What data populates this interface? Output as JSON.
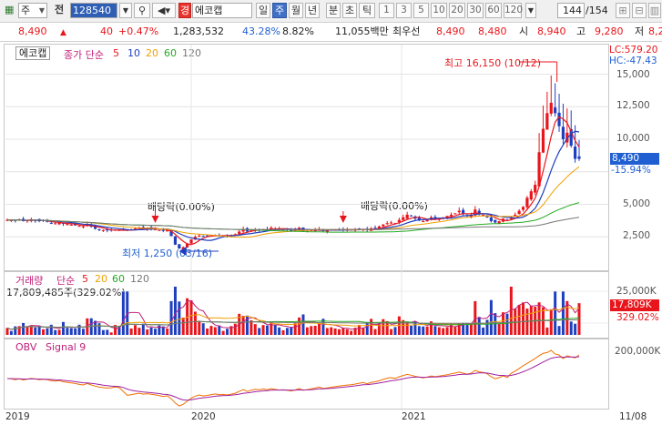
{
  "toolbar": {
    "market_type": "주",
    "prev_label": "전",
    "code": "128540",
    "search_icon": "search-icon",
    "name": "에코캡",
    "periods": [
      "일",
      "주",
      "월",
      "년",
      "분",
      "초",
      "틱"
    ],
    "active_period": "주",
    "intervals": [
      "1",
      "3",
      "5",
      "10",
      "20",
      "30",
      "60",
      "120"
    ],
    "count": "144",
    "total": "/154",
    "gold_box": "경"
  },
  "quote": {
    "price": "8,490",
    "change": "40",
    "change_rate": "+0.47%",
    "volume": "1,283,532",
    "volume_ratio": "43.28%",
    "turnover": "8.82%",
    "amount": "11,055백만",
    "ask_label": "최우선",
    "ask": "8,490",
    "bid": "8,480",
    "open_label": "시",
    "open": "8,940",
    "high_label": "고",
    "high": "9,280",
    "low_label": "저",
    "low": "8,2"
  },
  "price_panel": {
    "name_tag": "에코캡",
    "legend_main": "종가 단순",
    "ma_periods": [
      "5",
      "10",
      "20",
      "60",
      "120"
    ],
    "ma_colors": [
      "#e8161c",
      "#1f3fbf",
      "#f0a000",
      "#22aa22",
      "#777777"
    ],
    "lc": "LC:579.20",
    "hc": "HC:-47.43",
    "y_ticks": [
      "15,000",
      "12,500",
      "10,000",
      "7,500",
      "5,000",
      "2,500"
    ],
    "current_tag": "8,490",
    "current_pct": "-15.94%",
    "high_anno": "최고 16,150 (10/12)",
    "low_anno": "최저 1,250 (03/16)",
    "div1": "배당락(0.00%)",
    "div2": "배당락(0.00%)"
  },
  "volume_panel": {
    "legend_main": "거래량",
    "legend_sub": "단순",
    "ma_periods": [
      "5",
      "20",
      "60",
      "120"
    ],
    "value": "17,809,485주(329.02%)",
    "y_ticks": [
      "25,000K",
      "15,000"
    ],
    "current_tag": "17,809K",
    "current_pct": "329.02%"
  },
  "obv_panel": {
    "legend_main": "OBV",
    "legend_sub": "Signal 9",
    "y_ticks": [
      "200,000K"
    ]
  },
  "x_axis": [
    "2019",
    "2020",
    "2021",
    "11/08"
  ],
  "chart_data": {
    "type": "candlestick",
    "title": "",
    "ylim": [
      0,
      16500
    ],
    "weeks": 144,
    "close": [
      3800,
      3790,
      3760,
      3820,
      3700,
      3780,
      3850,
      3760,
      3700,
      3720,
      3650,
      3560,
      3540,
      3590,
      3500,
      3480,
      3430,
      3380,
      3340,
      3300,
      3470,
      3280,
      3120,
      3050,
      3020,
      2990,
      2990,
      3040,
      3020,
      3000,
      2990,
      3050,
      3150,
      3200,
      3150,
      3200,
      3120,
      3080,
      3020,
      2980,
      3030,
      2560,
      1900,
      1600,
      1700,
      2000,
      2300,
      2500,
      2600,
      2550,
      2580,
      2600,
      2620,
      2580,
      2600,
      2560,
      2620,
      2700,
      2900,
      3100,
      2900,
      3000,
      3050,
      3000,
      3100,
      3050,
      3200,
      3150,
      3100,
      3100,
      3050,
      2990,
      3050,
      3200,
      2900,
      2950,
      3020,
      3050,
      3100,
      2950,
      3000,
      3050,
      3050,
      3050,
      3050,
      3050,
      3050,
      3050,
      3100,
      3100,
      3000,
      3150,
      3150,
      3300,
      3450,
      3550,
      3600,
      3550,
      3800,
      4000,
      4200,
      4100,
      3900,
      3800,
      3700,
      3800,
      4000,
      3900,
      3950,
      4000,
      4100,
      4200,
      4300,
      4500,
      4300,
      4100,
      4200,
      4600,
      4300,
      4200,
      4000,
      3700,
      3600,
      3700,
      3900,
      3800,
      4000,
      4200,
      4500,
      4800,
      5500,
      6000,
      6500,
      9000,
      10800,
      12000,
      12800,
      12000,
      11000,
      10000,
      10500,
      9500,
      8490,
      8490
    ],
    "ma_series": [
      "MA5",
      "MA10",
      "MA20",
      "MA60",
      "MA120"
    ]
  }
}
